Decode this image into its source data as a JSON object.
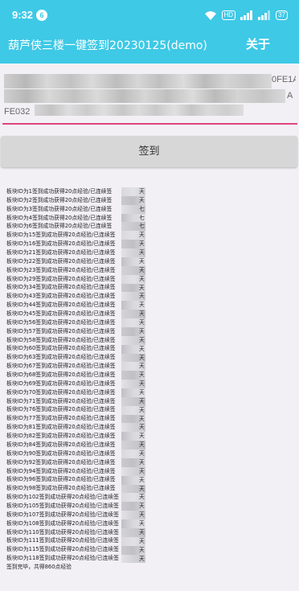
{
  "status_bar": {
    "time": "9:32",
    "notification_count": "6",
    "icons": [
      "wifi-icon",
      "hd-icon",
      "signal-icon",
      "signal-icon",
      "battery-icon"
    ],
    "hd_label": "HD",
    "battery": "37"
  },
  "app_bar": {
    "title": "葫芦侠三楼一键签到20230125(demo)",
    "about_label": "关于",
    "color": "#3ec9e6"
  },
  "token_input": {
    "visible_fragments": [
      "0FE1A",
      "A",
      "FE032"
    ]
  },
  "signin_button": {
    "label": "签到"
  },
  "log": {
    "lines": [
      "板块ID为1签到成功获得20点经验/已连续签",
      "板块ID为2签到成功获得20点经验/已连续签",
      "板块ID为3签到成功获得20点经验/已连续签",
      "板块ID为4签到成功获得20点经验/已连续签",
      "板块ID为6签到成功获得20点经验/已连续签",
      "板块ID为15签到成功获得20点经验/已连续签",
      "板块ID为16签到成功获得20点经验/已连续签",
      "板块ID为21签到成功获得20点经验/已连续签",
      "板块ID为22签到成功获得20点经验/已连续签",
      "板块ID为23签到成功获得20点经验/已连续签",
      "板块ID为29签到成功获得20点经验/已连续签",
      "板块ID为34签到成功获得20点经验/已连续签",
      "板块ID为43签到成功获得20点经验/已连续签",
      "板块ID为44签到成功获得20点经验/已连续签",
      "板块ID为45签到成功获得20点经验/已连续签",
      "板块ID为56签到成功获得20点经验/已连续签",
      "板块ID为57签到成功获得20点经验/已连续签",
      "板块ID为58签到成功获得20点经验/已连续签",
      "板块ID为60签到成功获得20点经验/已连续签",
      "板块ID为63签到成功获得20点经验/已连续签",
      "板块ID为67签到成功获得20点经验/已连续签",
      "板块ID为68签到成功获得20点经验/已连续签",
      "板块ID为69签到成功获得20点经验/已连续签",
      "板块ID为70签到成功获得20点经验/已连续签",
      "板块ID为71签到成功获得20点经验/已连续签",
      "板块ID为76签到成功获得20点经验/已连续签",
      "板块ID为77签到成功获得20点经验/已连续签",
      "板块ID为81签到成功获得20点经验/已连续签",
      "板块ID为82签到成功获得20点经验/已连续签",
      "板块ID为84签到成功获得20点经验/已连续签",
      "板块ID为90签到成功获得20点经验/已连续签",
      "板块ID为92签到成功获得20点经验/已连续签",
      "板块ID为94签到成功获得20点经验/已连续签",
      "板块ID为96签到成功获得20点经验/已连续签",
      "板块ID为98签到成功获得20点经验/已连续签",
      "板块ID为102签到成功获得20点经验/已连续签",
      "板块ID为105签到成功获得20点经验/已连续签",
      "板块ID为107签到成功获得20点经验/已连续签",
      "板块ID为108签到成功获得20点经验/已连续签",
      "板块ID为110签到成功获得20点经验/已连续签",
      "板块ID为111签到成功获得20点经验/已连续签",
      "板块ID为115签到成功获得20点经验/已连续签",
      "板块ID为118签到成功获得20点经验/已连续签"
    ],
    "line_suffixes": [
      "天",
      "天",
      "七",
      "七",
      "七",
      "天",
      "天",
      "天",
      "天",
      "天",
      "天",
      "天",
      "天",
      "天",
      "天",
      "天",
      "天",
      "天",
      "天",
      "天",
      "天",
      "天",
      "天",
      "天",
      "天",
      "天",
      "天",
      "天",
      "天",
      "天",
      "天",
      "天",
      "天",
      "天",
      "天",
      "天",
      "天",
      "天",
      "天",
      "天",
      "天",
      "天",
      "天"
    ],
    "summary": "签到完毕，共得860点经验"
  }
}
